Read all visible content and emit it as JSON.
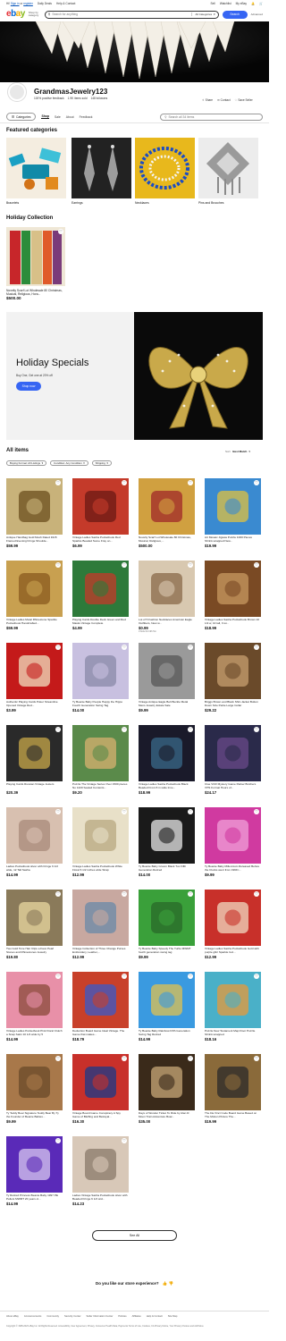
{
  "topbar": {
    "signin": "Sign in",
    "register": "register",
    "greeting_prefix": "Hi!",
    "greeting_or": "or",
    "links": [
      "Daily Deals",
      "Help & Contact"
    ],
    "right": [
      "Sell",
      "Watchlist",
      "My eBay"
    ]
  },
  "header": {
    "logo": {
      "e": "e",
      "b": "b",
      "a": "a",
      "y": "y"
    },
    "shop_by_category": "Shop by category",
    "search_placeholder": "Search for anything",
    "category_select": "All Categories",
    "search_button": "Search",
    "advanced": "Advanced"
  },
  "store": {
    "name": "GrandmasJewelry123",
    "feedback": "100% positive feedback",
    "items_sold": "1.9K items sold",
    "followers": "148 followers",
    "actions": [
      "Share",
      "Contact",
      "Save Seller"
    ]
  },
  "nav": {
    "categories": "Categories",
    "tabs": [
      "Shop",
      "Sale",
      "About",
      "Feedback"
    ],
    "search_placeholder": "Search all 34 items"
  },
  "featured": {
    "title": "Featured categories",
    "items": [
      {
        "label": "Bracelets"
      },
      {
        "label": "Earrings"
      },
      {
        "label": "Necklaces"
      },
      {
        "label": "Pins and Brooches"
      }
    ]
  },
  "holiday": {
    "title": "Holiday Collection",
    "item": {
      "title": "Novelty Scarf Lot Wholesale 80 Christmas, Musical, Religious, Hora...",
      "price": "$500.00"
    }
  },
  "specials": {
    "title": "Holiday Specials",
    "subtitle": "Buy One, Get one at 20% off",
    "button": "Shop now"
  },
  "all_items": {
    "title": "All items",
    "sort_label": "Sort:",
    "sort_value": "Best Match",
    "filters": [
      "Buying Format: All Listings",
      "Condition: Any Condition",
      "Shipping"
    ],
    "items": [
      {
        "title": "Antique Handbag Gold Mesh Dated 1915 Framed Evening Fringe Shoulde...",
        "price": "$59.99",
        "ship": ""
      },
      {
        "title": "Vintage Ladies Sasha Pocketbook Red Sparkle Beaded Some Fray on...",
        "price": "$6.99",
        "ship": ""
      },
      {
        "title": "Novelty Scarf Lot Wholesale 80 Christmas, Musical, Religious,...",
        "price": "$500.00",
        "ship": ""
      },
      {
        "title": "Art Mosaic Jigsaw Puzzle 1000 Pieces Shrink-wrapped New...",
        "price": "$19.99",
        "ship": ""
      },
      {
        "title": "Vintage Ladies Metal Rhinestone Sparkle Pocketbook Handcrafted...",
        "price": "$59.99",
        "ship": ""
      },
      {
        "title": "Playing Cards Double Deck Green and Red Masks Vintage Complete",
        "price": "$4.99",
        "ship": ""
      },
      {
        "title": "Lot of 5 Fashion Necklaces American Eagle Outfitters, New w...",
        "price": "$0.99",
        "ship": "3 bids 6d 19h 5m"
      },
      {
        "title": "Vintage Ladies Sasha Pocketbook Brown 10 1/2 w, 10 tall, 3 wi...",
        "price": "$18.99",
        "ship": ""
      },
      {
        "title": "Authentic Playing Cards Poker Streamline Opened Vintage Red...",
        "price": "$3.99",
        "ship": ""
      },
      {
        "title": "Ty Beanie Baby People Happy the Hippo Fourth Generation Swing Tag",
        "price": "$14.00",
        "ship": ""
      },
      {
        "title": "Vintage Antique Eagle Belt Buckle Metal Mens Jewelry Estate Sale",
        "price": "$9.99",
        "ship": ""
      },
      {
        "title": "Briggs Brown and Black Shirt-Jacket Button Down Size Petite Large Collar",
        "price": "$29.22",
        "ship": ""
      },
      {
        "title": "Playing Cards Russian Vintage Jesters",
        "price": "$20.39",
        "ship": ""
      },
      {
        "title": "Puzzle The Vintage Series Over 1500 pieces No 1420 Sealed Contents...",
        "price": "$9.20",
        "ship": ""
      },
      {
        "title": "Vintage Ladies Sasha Pocketbook Black Beaded Front 8 in wide Inne...",
        "price": "$18.99",
        "ship": ""
      },
      {
        "title": "Clue VCR Mystery Game Parker Brothers VHS Format Hours of...",
        "price": "$24.17",
        "ship": ""
      },
      {
        "title": "Ladies Pocketbook silver with Fringe 6 1/2 wide, 12 Tall Sasha",
        "price": "$14.99",
        "ship": ""
      },
      {
        "title": "Vintage Ladies Sasha Pocketbook White Floral 6 1/2 inches wide Strap",
        "price": "$12.99",
        "ship": ""
      },
      {
        "title": "Ty Beanie Baby Groom Black Tux Fifth Generation Retired",
        "price": "$14.00",
        "ship": ""
      },
      {
        "title": "Ty Beanie Baby Millennium Released Before the Clocks went from 1999 t...",
        "price": "$9.99",
        "ship": ""
      },
      {
        "title": "Two Gold Tone Hair Clips a Faux Pearl Stones and Rhinestones Jewelry",
        "price": "$19.80",
        "ship": ""
      },
      {
        "title": "Vintage Collection of Three Change Purses Embroidery, Leather,...",
        "price": "$12.99",
        "ship": ""
      },
      {
        "title": "Ty Beanie Baby Speedy The Turtle MWMT fourth generation swing tag",
        "price": "$9.99",
        "ship": ""
      },
      {
        "title": "Vintage Ladies Sasha Pocketbook Gold with purple glitz Sparkle Gol...",
        "price": "$12.99",
        "ship": ""
      },
      {
        "title": "Vintage Ladies Pocketbook Pink Floral Clutch a Snap Satin 10 1/2 wide by 5",
        "price": "$14.99",
        "ship": ""
      },
      {
        "title": "Deduction Board Game Ideal Vintage. The Game that makes...",
        "price": "$18.79",
        "ship": ""
      },
      {
        "title": "Ty Beanie Baby Rainbow Fifth Generation Swing Tag Retired",
        "price": "$14.99",
        "ship": ""
      },
      {
        "title": "Puzzle New Testament Map Floor Puzzle Shrink-wrapped",
        "price": "$18.16",
        "ship": ""
      },
      {
        "title": "Ty Teddy Bear Signature Teddy Bear By Ty the Founder of Beanie Babies...",
        "price": "$9.99",
        "ship": ""
      },
      {
        "title": "Vintage Board Game Conspiracy A Spy Game of Bluffing and Betrayal...",
        "price": "$16.30",
        "ship": ""
      },
      {
        "title": "Days of Wonder Ticket To Ride by Alan R. Moon Train Adventure Boar...",
        "price": "$35.00",
        "ship": ""
      },
      {
        "title": "The Da Vinci Code Board Game Based on The Motion Picture The...",
        "price": "$19.99",
        "ship": ""
      },
      {
        "title": "Ty Retired Princess Beanie Baby 1997 PE Pellets MWMT 20 years ol...",
        "price": "$14.99",
        "ship": ""
      },
      {
        "title": "Ladies Vintage Sasha Pocketbook silver with Beaded Fringe 6 1/2 wid...",
        "price": "$14.23",
        "ship": ""
      }
    ],
    "see_all": "See All"
  },
  "feedback_prompt": "Do you like our store experience?",
  "footer": {
    "links": [
      "About eBay",
      "Announcements",
      "Community",
      "Security Center",
      "Seller Information Center",
      "Policies",
      "Affiliates",
      "Help & Contact",
      "Site Map"
    ],
    "copyright": "Copyright © 1995-2023 eBay Inc. All Rights Reserved. Accessibility, User Agreement, Privacy, Consumer Health Data, Payments Terms of Use, Cookies, CA Privacy Notice, Your Privacy Choices and AdChoice"
  },
  "colors": {
    "accent": "#3665f3",
    "link": "#0654ba",
    "banner_bg": "#0c0c0c",
    "specials_bg": "#f2f2f2"
  }
}
